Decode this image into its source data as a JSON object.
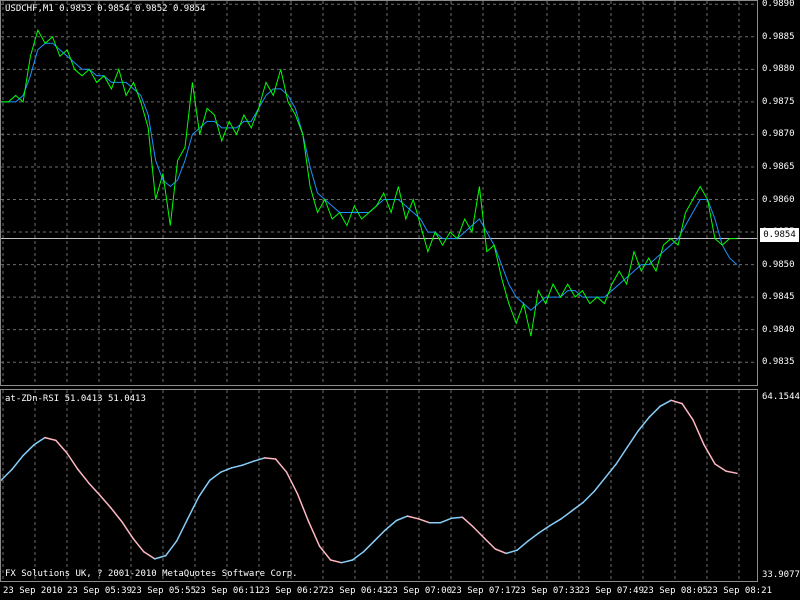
{
  "header": {
    "symbol_info": "USDCHF,M1  0.9853 0.9854 0.9852 0.9854"
  },
  "indicator": {
    "label": "at-ZDn-RSI 51.0413 51.0413",
    "max_label": "64.1544",
    "min_label": "33.9077"
  },
  "footer": {
    "copyright": "FX Solutions UK, ? 2001-2010 MetaQuotes Software Corp."
  },
  "current_price": "0.9854",
  "colors": {
    "price_line": "#00ff00",
    "ma_line": "#1e90ff",
    "rsi_up": "#87cefa",
    "rsi_down": "#ffb6c1",
    "grid": "#6b6b6b"
  },
  "chart_data": [
    {
      "type": "line",
      "x": [
        "23 Sep 2010",
        "23 Sep 05:39",
        "23 Sep 05:55",
        "23 Sep 06:11",
        "23 Sep 06:27",
        "23 Sep 06:43",
        "23 Sep 07:00",
        "23 Sep 07:17",
        "23 Sep 07:33",
        "23 Sep 07:49",
        "23 Sep 08:05",
        "23 Sep 08:21"
      ],
      "y_ticks": [
        "0.9890",
        "0.9885",
        "0.9880",
        "0.9875",
        "0.9870",
        "0.9865",
        "0.9860",
        "0.9855",
        "0.9850",
        "0.9845",
        "0.9840",
        "0.9835"
      ],
      "ylim": [
        0.98315,
        0.98905
      ],
      "series": [
        {
          "values": [
            0.9875,
            0.9875,
            0.9876,
            0.9875,
            0.9882,
            0.9886,
            0.9884,
            0.9885,
            0.9882,
            0.9883,
            0.988,
            0.9879,
            0.988,
            0.9878,
            0.9879,
            0.9877,
            0.988,
            0.9876,
            0.9878,
            0.9875,
            0.9871,
            0.986,
            0.9864,
            0.9856,
            0.9866,
            0.9868,
            0.9878,
            0.987,
            0.9874,
            0.9873,
            0.9869,
            0.9872,
            0.987,
            0.9873,
            0.9871,
            0.9874,
            0.9878,
            0.9876,
            0.988,
            0.9875,
            0.9873,
            0.987,
            0.9862,
            0.9858,
            0.986,
            0.9857,
            0.9858,
            0.9856,
            0.9859,
            0.9857,
            0.9858,
            0.9859,
            0.9861,
            0.9858,
            0.9862,
            0.9857,
            0.986,
            0.9856,
            0.9852,
            0.9855,
            0.9853,
            0.9855,
            0.9854,
            0.9857,
            0.9855,
            0.9862,
            0.9852,
            0.9853,
            0.9848,
            0.9844,
            0.9841,
            0.9844,
            0.9839,
            0.9846,
            0.9844,
            0.9847,
            0.9845,
            0.9847,
            0.9845,
            0.9846,
            0.9844,
            0.9845,
            0.9844,
            0.9847,
            0.9849,
            0.9847,
            0.9852,
            0.9849,
            0.9851,
            0.9849,
            0.9853,
            0.9854,
            0.9853,
            0.9858,
            0.986,
            0.9862,
            0.986,
            0.9854,
            0.9853,
            0.9854,
            0.9854
          ]
        },
        {
          "values": [
            0.9875,
            0.9875,
            0.9875,
            0.9876,
            0.9879,
            0.9883,
            0.9884,
            0.9884,
            0.9883,
            0.9882,
            0.9881,
            0.988,
            0.988,
            0.9879,
            0.9879,
            0.9878,
            0.9878,
            0.9878,
            0.9877,
            0.9876,
            0.9873,
            0.9866,
            0.9863,
            0.9862,
            0.9863,
            0.9866,
            0.987,
            0.9871,
            0.9872,
            0.9872,
            0.9871,
            0.9871,
            0.9871,
            0.9872,
            0.9872,
            0.9874,
            0.9876,
            0.9877,
            0.9877,
            0.9876,
            0.9874,
            0.987,
            0.9865,
            0.9861,
            0.986,
            0.9859,
            0.9858,
            0.9858,
            0.9858,
            0.9858,
            0.9858,
            0.9859,
            0.986,
            0.986,
            0.986,
            0.9859,
            0.9858,
            0.9857,
            0.9855,
            0.9855,
            0.9854,
            0.9854,
            0.9854,
            0.9855,
            0.9856,
            0.9857,
            0.9855,
            0.9853,
            0.985,
            0.9847,
            0.9845,
            0.9844,
            0.9843,
            0.9844,
            0.9845,
            0.9845,
            0.9845,
            0.9846,
            0.9846,
            0.9845,
            0.9845,
            0.9845,
            0.9845,
            0.9846,
            0.9847,
            0.9848,
            0.9849,
            0.985,
            0.985,
            0.9851,
            0.9852,
            0.9853,
            0.9854,
            0.9856,
            0.9858,
            0.986,
            0.986,
            0.9857,
            0.9853,
            0.9851,
            0.985
          ]
        }
      ]
    },
    {
      "type": "line",
      "ylim": [
        33.9077,
        64.1544
      ],
      "series": [
        {
          "values": [
            49.5,
            51.5,
            54.0,
            56.0,
            57.3,
            56.8,
            54.5,
            51.5,
            49.0,
            46.8,
            44.5,
            42.0,
            39.0,
            36.5,
            35.2,
            35.8,
            38.5,
            42.5,
            46.5,
            49.5,
            51.0,
            51.8,
            52.3,
            53.0,
            53.6,
            53.4,
            51.0,
            47.0,
            42.0,
            37.5,
            35.0,
            34.5,
            35.0,
            36.5,
            38.5,
            40.5,
            42.2,
            43.0,
            42.5,
            41.8,
            41.8,
            42.6,
            42.8,
            41.0,
            39.0,
            37.0,
            36.2,
            36.8,
            38.5,
            40.0,
            41.3,
            42.5,
            44.0,
            45.5,
            47.5,
            50.0,
            52.5,
            55.5,
            58.5,
            61.0,
            63.0,
            64.1,
            63.5,
            60.5,
            56.0,
            52.5,
            51.2,
            50.8
          ]
        }
      ]
    }
  ]
}
